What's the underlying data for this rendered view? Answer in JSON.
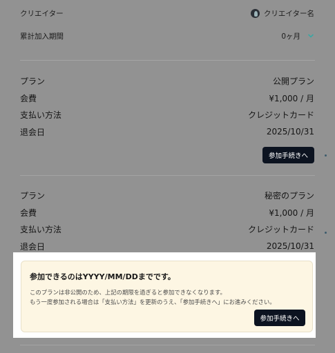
{
  "creator": {
    "label": "クリエイター",
    "name": "クリエイター名"
  },
  "period": {
    "label": "累計加入期間",
    "value": "0ヶ月"
  },
  "plan1": {
    "plan_label": "プラン",
    "plan_value": "公開プラン",
    "fee_label": "会費",
    "fee_value": "¥1,000 / 月",
    "payment_label": "支払い方法",
    "payment_value": "クレジットカード",
    "leave_label": "退会日",
    "leave_value": "2025/10/31",
    "button": "参加手続きへ"
  },
  "plan2": {
    "plan_label": "プラン",
    "plan_value": "秘密のプラン",
    "fee_label": "会費",
    "fee_value": "¥1,000 / 月",
    "payment_label": "支払い方法",
    "payment_value": "クレジットカード",
    "leave_label": "退会日",
    "leave_value": "2025/10/31"
  },
  "notice": {
    "title": "参加できるのはYYYY/MM/DDまでです。",
    "line1": "このプランは非公開のため、上記の期限を過ぎると参加できなくなります。",
    "line2": "もう一度参加される場合は「支払い方法」を更新のうえ、「参加手続きへ」にお進みください。",
    "button": "参加手続きへ"
  },
  "colors": {
    "accent": "#0c1320",
    "notice_bg": "#fdf6e3",
    "chevron": "#3aa7a3"
  }
}
